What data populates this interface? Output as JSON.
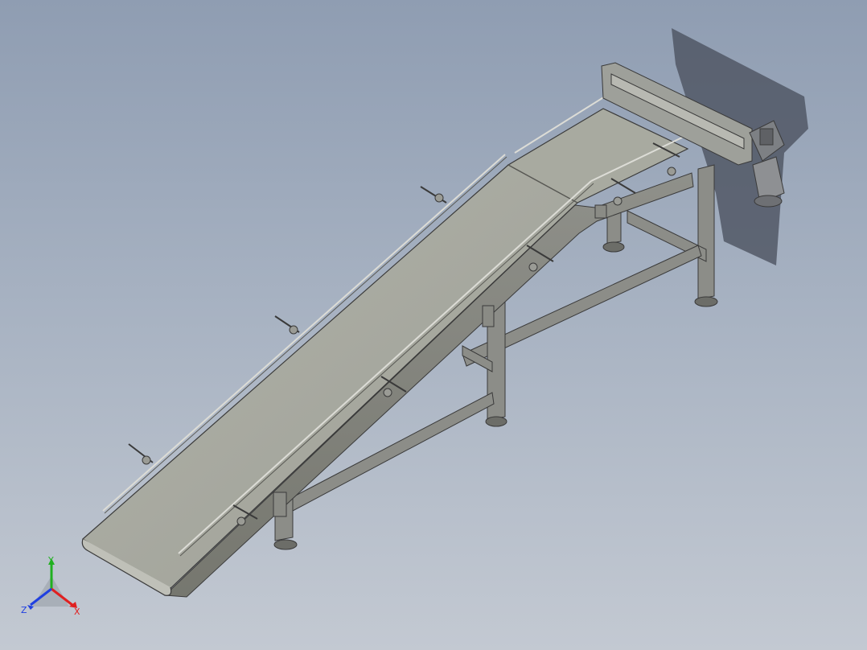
{
  "viewport": {
    "background_top": "#8f9db2",
    "background_bottom": "#c3c9d2"
  },
  "model": {
    "belt_color": "#a3a59c",
    "frame_color": "#8c8d88",
    "edge_color": "#3a3a3a",
    "motor_color": "#8e9093"
  },
  "triad": {
    "x_label": "X",
    "y_label": "Y",
    "z_label": "Z",
    "x_color": "#e02020",
    "y_color": "#20b020",
    "z_color": "#2040e0"
  }
}
